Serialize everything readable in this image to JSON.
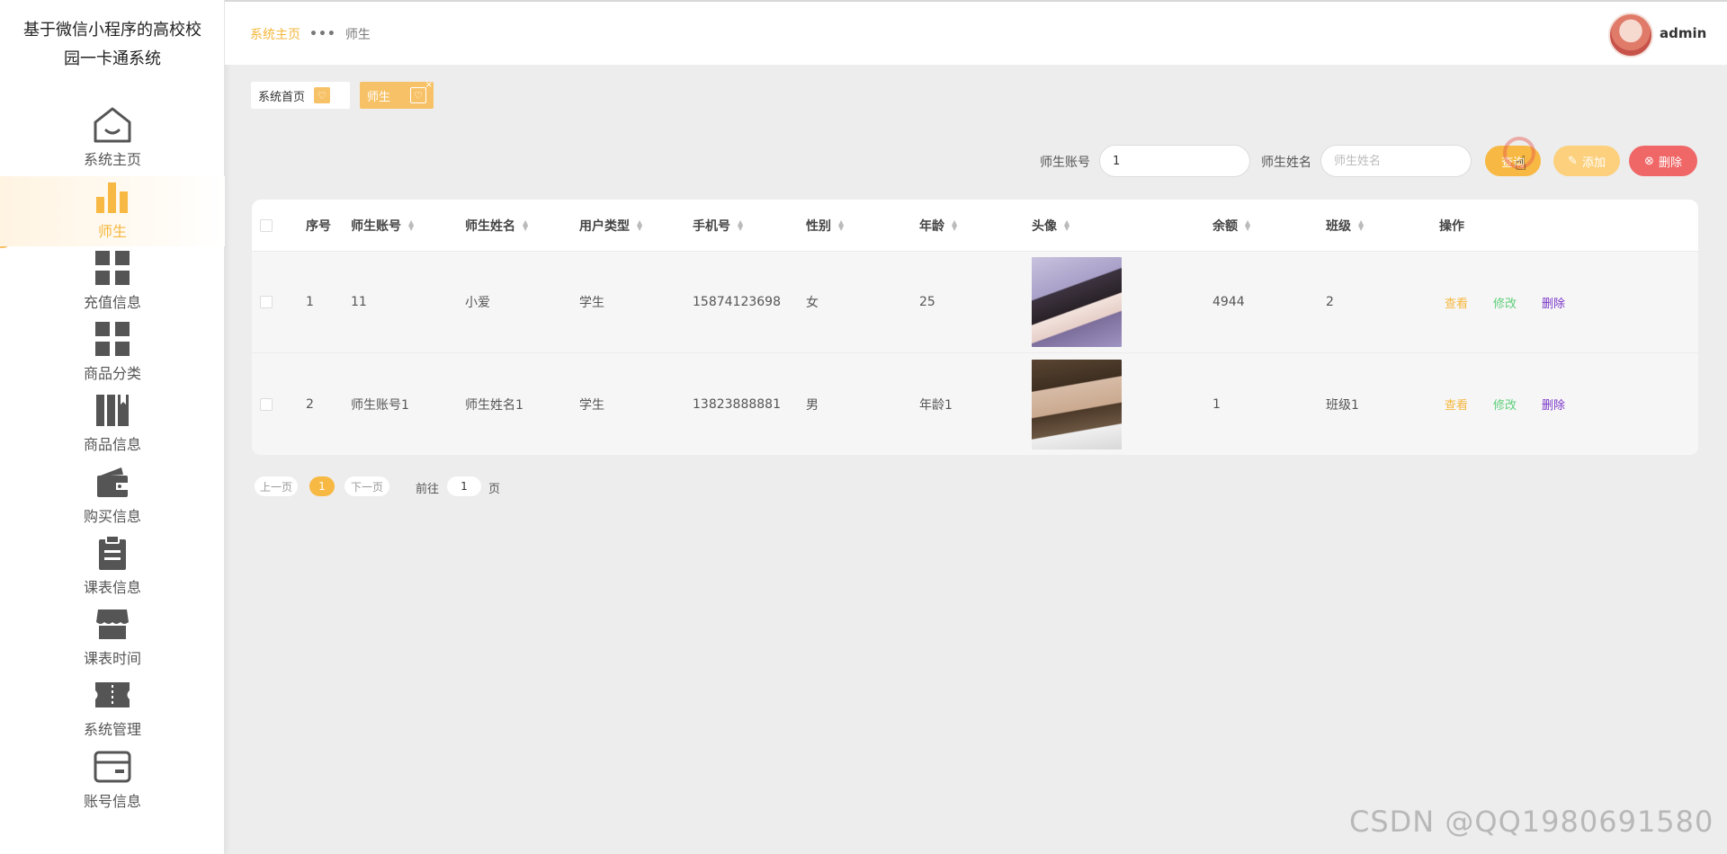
{
  "app": {
    "title": "基于微信小程序的高校校园一卡通系统"
  },
  "colors": {
    "accent": "#f7b943",
    "danger": "#f06767",
    "edit": "#5fcf7a",
    "delete_link": "#7a35c9"
  },
  "sidebar": {
    "items": [
      {
        "label": "系统主页",
        "icon": "home-icon"
      },
      {
        "label": "师生",
        "icon": "bar-chart-icon",
        "active": true
      },
      {
        "label": "充值信息",
        "icon": "grid-icon"
      },
      {
        "label": "商品分类",
        "icon": "grid-icon"
      },
      {
        "label": "商品信息",
        "icon": "book-icon"
      },
      {
        "label": "购买信息",
        "icon": "wallet-icon"
      },
      {
        "label": "课表信息",
        "icon": "clipboard-icon"
      },
      {
        "label": "课表时间",
        "icon": "store-icon"
      },
      {
        "label": "系统管理",
        "icon": "ticket-icon"
      },
      {
        "label": "账号信息",
        "icon": "card-icon"
      }
    ]
  },
  "header": {
    "breadcrumb": {
      "home": "系统主页",
      "current": "师生"
    },
    "user": "admin"
  },
  "tags": {
    "home": "系统首页",
    "current": "师生",
    "close": "×"
  },
  "search": {
    "account_label": "师生账号",
    "account_value": "1",
    "name_label": "师生姓名",
    "name_placeholder": "师生姓名",
    "search_button": "查询",
    "add_button": "添加",
    "delete_button": "删除"
  },
  "table": {
    "headers": [
      "序号",
      "师生账号",
      "师生姓名",
      "用户类型",
      "手机号",
      "性别",
      "年龄",
      "头像",
      "余额",
      "班级",
      "操作"
    ],
    "rows": [
      {
        "index": "1",
        "account": "11",
        "name": "小爱",
        "type": "学生",
        "phone": "15874123698",
        "gender": "女",
        "age": "25",
        "balance": "4944",
        "class": "2"
      },
      {
        "index": "2",
        "account": "师生账号1",
        "name": "师生姓名1",
        "type": "学生",
        "phone": "13823888881",
        "gender": "男",
        "age": "年龄1",
        "balance": "1",
        "class": "班级1"
      }
    ],
    "actions": {
      "view": "查看",
      "edit": "修改",
      "delete": "删除"
    }
  },
  "pagination": {
    "prev": "上一页",
    "current": "1",
    "next": "下一页",
    "goto": "前往",
    "page_value": "1",
    "unit": "页"
  },
  "watermark": "CSDN @QQ1980691580"
}
